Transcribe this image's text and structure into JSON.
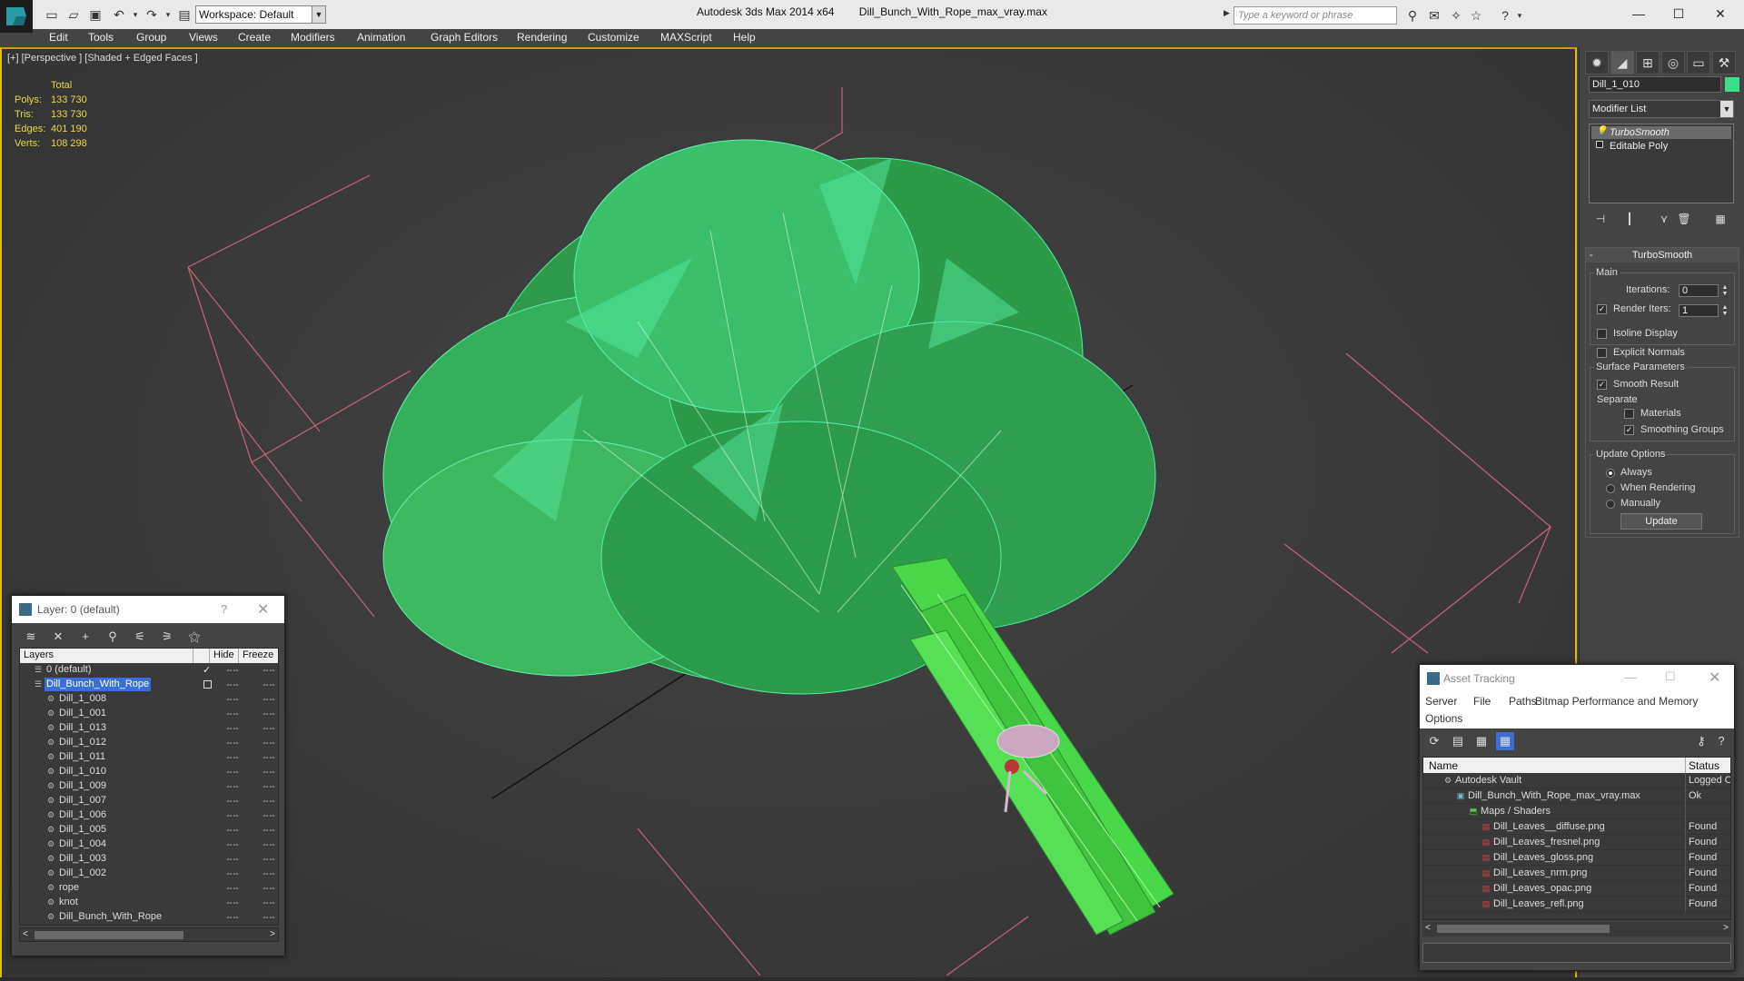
{
  "window": {
    "app_title": "Autodesk 3ds Max  2014 x64",
    "file_title": "Dill_Bunch_With_Rope_max_vray.max",
    "workspace": "Workspace: Default",
    "search_placeholder": "Type a keyword or phrase",
    "minimize": "—",
    "maximize": "☐",
    "close": "✕"
  },
  "menu": [
    "Edit",
    "Tools",
    "Group",
    "Views",
    "Create",
    "Modifiers",
    "Animation",
    "Graph Editors",
    "Rendering",
    "Customize",
    "MAXScript",
    "Help"
  ],
  "viewport": {
    "label": "[+] [Perspective ] [Shaded + Edged Faces ]",
    "stats": {
      "header": "Total",
      "rows": [
        {
          "key": "Polys:",
          "value": "133 730"
        },
        {
          "key": "Tris:",
          "value": "133 730"
        },
        {
          "key": "Edges:",
          "value": "401 190"
        },
        {
          "key": "Verts:",
          "value": "108 298"
        }
      ]
    }
  },
  "command_panel": {
    "object_name": "Dill_1_010",
    "object_color": "#3cdc8c",
    "modifier_list": "Modifier List",
    "stack": [
      "TurboSmooth",
      "Editable Poly"
    ],
    "rollout_title": "TurboSmooth",
    "main_label": "Main",
    "iterations_label": "Iterations:",
    "iterations_value": "0",
    "render_iters_label": "Render Iters:",
    "render_iters_value": "1",
    "isoline_label": "Isoline Display",
    "explicit_normals_label": "Explicit Normals",
    "surface_params_label": "Surface Parameters",
    "smooth_result_label": "Smooth Result",
    "separate_label": "Separate",
    "materials_label": "Materials",
    "smoothing_groups_label": "Smoothing Groups",
    "update_options_label": "Update Options",
    "always_label": "Always",
    "when_rendering_label": "When Rendering",
    "manually_label": "Manually",
    "update_button": "Update"
  },
  "layer_dialog": {
    "title": "Layer: 0 (default)",
    "help": "?",
    "close": "✕",
    "columns": [
      "Layers",
      "Hide",
      "Freeze"
    ],
    "rows": [
      {
        "name": "0 (default)",
        "level": 1,
        "hide_check": true
      },
      {
        "name": "Dill_Bunch_With_Rope",
        "level": 1,
        "selected": true,
        "hide_box": true
      },
      {
        "name": "Dill_1_008",
        "level": 2
      },
      {
        "name": "Dill_1_001",
        "level": 2
      },
      {
        "name": "Dill_1_013",
        "level": 2
      },
      {
        "name": "Dill_1_012",
        "level": 2
      },
      {
        "name": "Dill_1_011",
        "level": 2
      },
      {
        "name": "Dill_1_010",
        "level": 2
      },
      {
        "name": "Dill_1_009",
        "level": 2
      },
      {
        "name": "Dill_1_007",
        "level": 2
      },
      {
        "name": "Dill_1_006",
        "level": 2
      },
      {
        "name": "Dill_1_005",
        "level": 2
      },
      {
        "name": "Dill_1_004",
        "level": 2
      },
      {
        "name": "Dill_1_003",
        "level": 2
      },
      {
        "name": "Dill_1_002",
        "level": 2
      },
      {
        "name": "rope",
        "level": 2
      },
      {
        "name": "knot",
        "level": 2
      },
      {
        "name": "Dill_Bunch_With_Rope",
        "level": 2
      }
    ]
  },
  "asset_dialog": {
    "title": "Asset Tracking",
    "menu": [
      "Server",
      "File",
      "Paths",
      "Bitmap Performance and Memory",
      "Options"
    ],
    "columns": [
      "Name",
      "Status"
    ],
    "rows": [
      {
        "name": "Autodesk Vault",
        "status": "Logged O",
        "level": 0,
        "icon": "vault-icon"
      },
      {
        "name": "Dill_Bunch_With_Rope_max_vray.max",
        "status": "Ok",
        "level": 1,
        "icon": "max-file-icon"
      },
      {
        "name": "Maps / Shaders",
        "status": "",
        "level": 2,
        "icon": "maps-icon"
      },
      {
        "name": "Dill_Leaves__diffuse.png",
        "status": "Found",
        "level": 3,
        "icon": "png-icon"
      },
      {
        "name": "Dill_Leaves_fresnel.png",
        "status": "Found",
        "level": 3,
        "icon": "png-icon"
      },
      {
        "name": "Dill_Leaves_gloss.png",
        "status": "Found",
        "level": 3,
        "icon": "png-icon"
      },
      {
        "name": "Dill_Leaves_nrm.png",
        "status": "Found",
        "level": 3,
        "icon": "png-icon"
      },
      {
        "name": "Dill_Leaves_opac.png",
        "status": "Found",
        "level": 3,
        "icon": "png-icon"
      },
      {
        "name": "Dill_Leaves_refl.png",
        "status": "Found",
        "level": 3,
        "icon": "png-icon"
      }
    ]
  }
}
